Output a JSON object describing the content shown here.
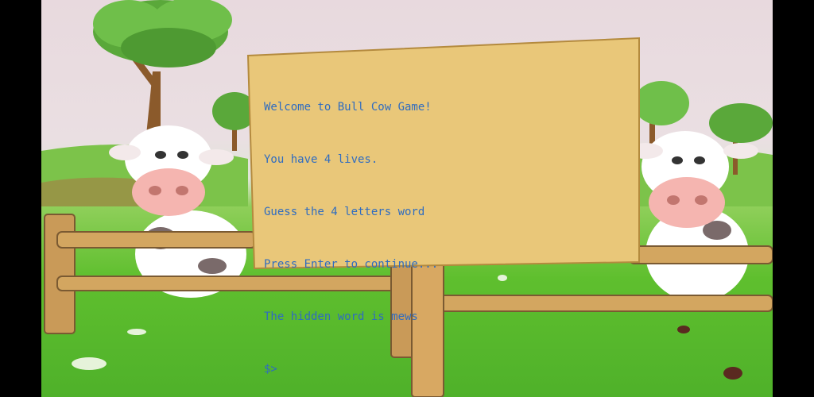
{
  "terminal": {
    "lines": [
      "Welcome to Bull Cow Game!",
      "You have 4 lives.",
      "Guess the 4 letters word",
      "Press Enter to continue...",
      "The hidden word is mews"
    ],
    "prompt": "$>"
  },
  "colors": {
    "text": "#2f6cc0",
    "sign": "#e9c779",
    "grass": "#5fbf2e",
    "sky": "#e8d9de",
    "wood": "#c99a58"
  }
}
